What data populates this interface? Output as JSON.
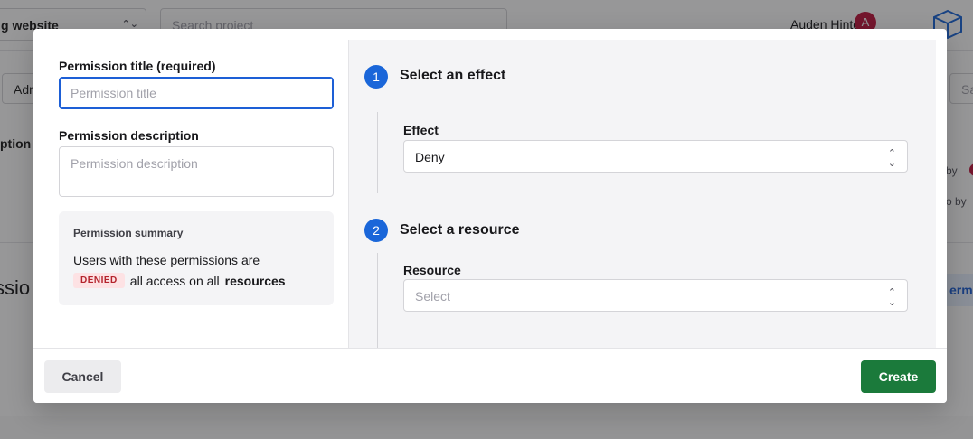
{
  "background": {
    "project_select": "g website",
    "search_placeholder": "Search project",
    "user_name": "Auden Hinton",
    "avatar_initial": "A",
    "role_button": "Adm",
    "save_button": "Sa",
    "caption_fragment": "ption",
    "by_text_1": "by",
    "by_text_2": "o by",
    "section_title_fragment": "ssio",
    "permissions_button_fragment": "erm"
  },
  "form": {
    "title_label": "Permission title (required)",
    "title_placeholder": "Permission title",
    "description_label": "Permission description",
    "description_placeholder": "Permission description"
  },
  "summary": {
    "heading": "Permission summary",
    "line1": "Users with these permissions are",
    "badge": "DENIED",
    "line2_text": "all access on all",
    "line2_bold": "resources"
  },
  "steps": [
    {
      "number": "1",
      "title": "Select an effect",
      "field_label": "Effect",
      "value": "Deny",
      "is_placeholder": false
    },
    {
      "number": "2",
      "title": "Select a resource",
      "field_label": "Resource",
      "value": "Select",
      "is_placeholder": true
    }
  ],
  "footer": {
    "cancel_label": "Cancel",
    "create_label": "Create"
  },
  "colors": {
    "accent": "#1a66d9",
    "create": "#1b7a3b",
    "denied_bg": "#fde2e4",
    "denied_text": "#b4232c"
  }
}
